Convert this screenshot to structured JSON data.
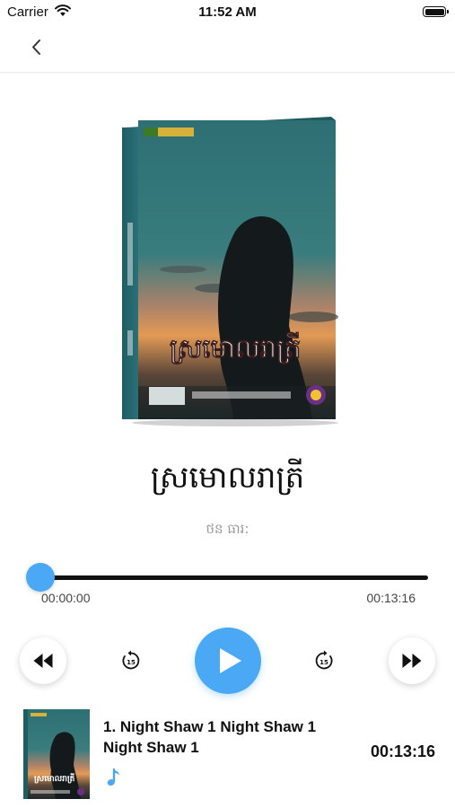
{
  "status_bar": {
    "carrier": "Carrier",
    "time": "11:52 AM"
  },
  "book": {
    "title": "ស្រមោលរាត្រី",
    "author": "ថន ធារ:",
    "cover_title": "ស្រមោលរាត្រី"
  },
  "player": {
    "current_time": "00:00:00",
    "total_time": "00:13:16",
    "progress_fraction": 0
  },
  "track": {
    "title": "1. Night Shaw 1 Night Shaw 1 Night Shaw 1",
    "duration": "00:13:16"
  },
  "colors": {
    "accent": "#4aa8f5",
    "progress_track": "#111111"
  },
  "icons": {
    "back": "chevron-left-icon",
    "rewind": "rewind-icon",
    "skip_back": "replay-15-icon",
    "play": "play-icon",
    "skip_forward": "forward-15-icon",
    "fast_forward": "fast-forward-icon",
    "track": "music-note-icon"
  }
}
